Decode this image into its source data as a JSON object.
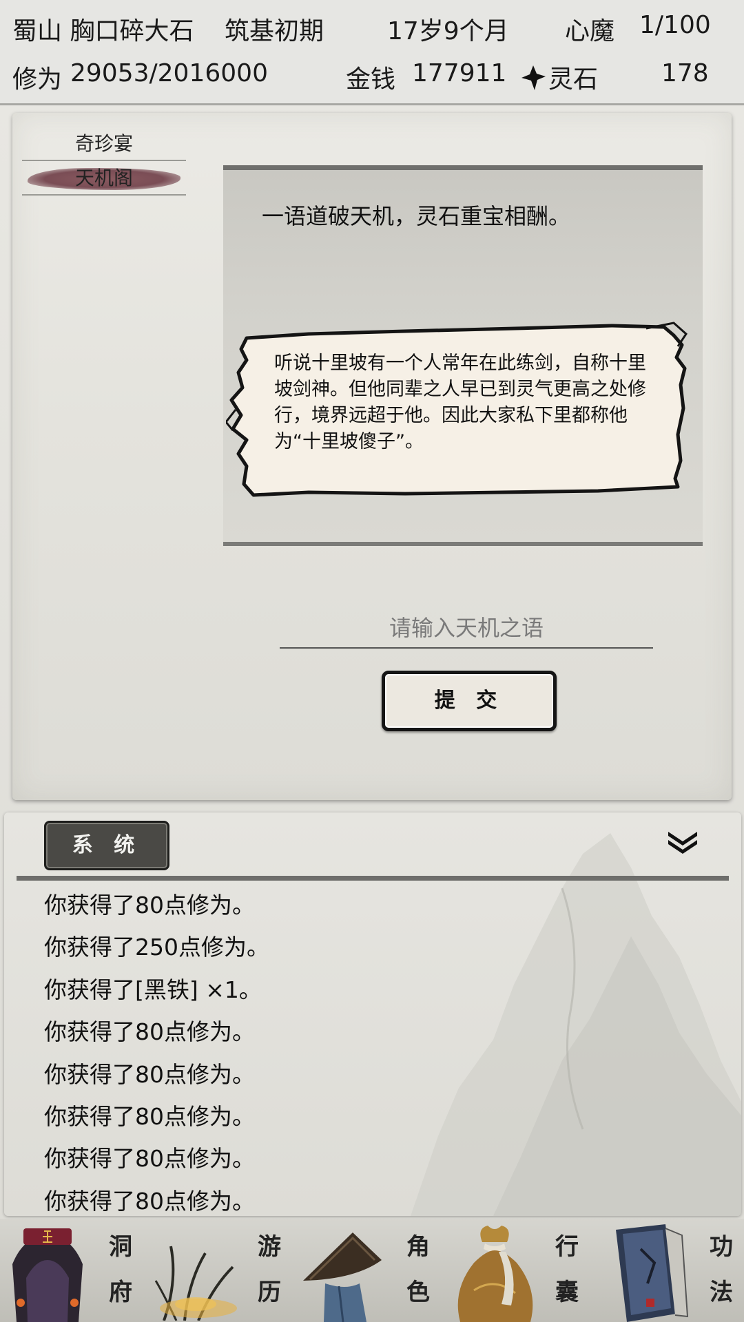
{
  "status": {
    "location": "蜀山 胸口碎大石",
    "realm": "筑基初期",
    "age": "17岁9个月",
    "demon_label": "心魔",
    "demon_value": "1/100",
    "cultivation_label": "修为",
    "cultivation_value": "29053/2016000",
    "money_label": "金钱",
    "money_value": "177911",
    "spirit_stone_label": "灵石",
    "spirit_stone_value": "178"
  },
  "sidebar": {
    "tabs": [
      {
        "label": "奇珍宴",
        "active": false
      },
      {
        "label": "天机阁",
        "active": true
      }
    ]
  },
  "main": {
    "tagline": "一语道破天机，灵石重宝相酬。",
    "note": "听说十里坡有一个人常年在此练剑，自称十里坡剑神。但他同辈之人早已到灵气更高之处修行，境界远超于他。因此大家私下里都称他为“十里坡傻子”。",
    "input_placeholder": "请输入天机之语",
    "submit_label": "提 交"
  },
  "log": {
    "tab_label": "系 统",
    "entries": [
      "你获得了80点修为。",
      "你获得了250点修为。",
      "你获得了[黑铁] ×1。",
      "你获得了80点修为。",
      "你获得了80点修为。",
      "你获得了80点修为。",
      "你获得了80点修为。",
      "你获得了80点修为。"
    ]
  },
  "nav": {
    "items": [
      {
        "top": "洞",
        "bottom": "府",
        "icon": "cave-dwelling-icon"
      },
      {
        "top": "游",
        "bottom": "历",
        "icon": "travel-grass-icon"
      },
      {
        "top": "角",
        "bottom": "色",
        "icon": "straw-hat-icon"
      },
      {
        "top": "行",
        "bottom": "囊",
        "icon": "bag-icon"
      },
      {
        "top": "功",
        "bottom": "法",
        "icon": "manual-book-icon"
      }
    ]
  },
  "colors": {
    "active_tab_ink": "#7a4d55",
    "log_tab_bg": "#4a4945",
    "note_paper": "#f5efe6"
  }
}
